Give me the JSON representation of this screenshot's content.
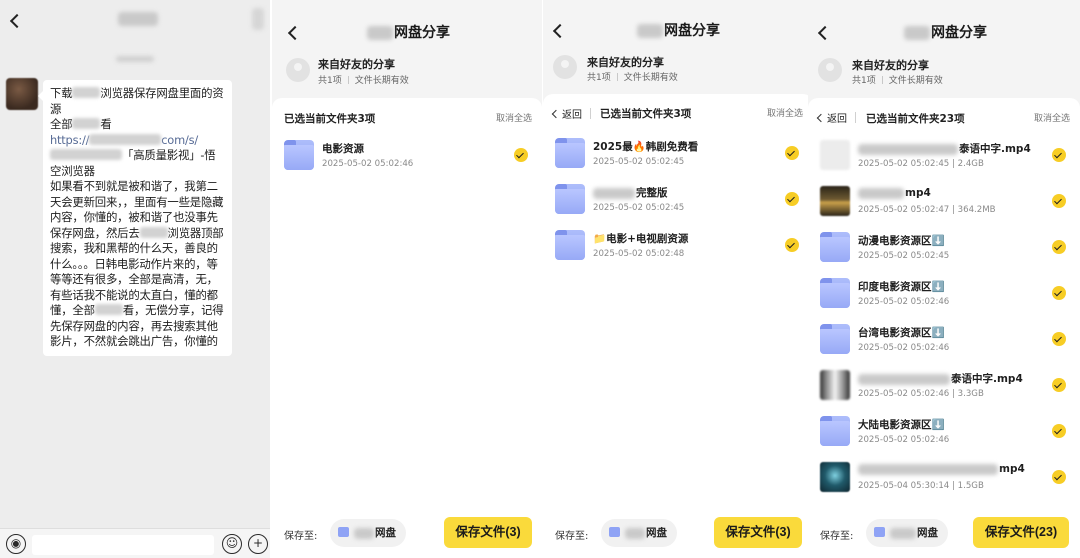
{
  "chat": {
    "message_lines": [
      {
        "pre": "下载",
        "post": "浏览器保存网盘里面的资"
      },
      {
        "text": "源"
      },
      {
        "pre": "全部",
        "post": "看"
      },
      {
        "link_pre": "https://",
        "link_post": "com/s/"
      },
      {
        "post": "「高质量影视」-悟"
      },
      {
        "text": "空浏览器"
      }
    ],
    "message_body_a": "如果看不到就是被和谐了，我第二天会更新回来，，里面有一些是隐藏内容，你懂的，被和谐了也没事先保存网盘，然后去",
    "message_body_b": "浏览器顶部搜索，我和黑帮的什么天，善良的什么。。。日韩电影动作片来的，等等等还有很多，全部是高清，无，有些话我不能说的太直白，懂的都懂，全部",
    "message_body_c": "看，无偿分享，记得先保存网盘的内容，再去搜索其他影片，不然就会跳出广告，你懂的"
  },
  "share_common": {
    "title_suffix": "网盘分享",
    "from_title": "来自好友的分享",
    "from_count": "共1项",
    "from_validity": "文件长期有效",
    "cancel_all": "取消全选",
    "back_label": "返回",
    "save_to_label": "保存至:",
    "dest_suffix": "网盘"
  },
  "panel1": {
    "selected": "已选当前文件夹3项",
    "items": [
      {
        "name": "电影资源",
        "meta": "2025-05-02 05:02:46"
      }
    ],
    "save_button": "保存文件(3)"
  },
  "panel2": {
    "selected": "已选当前文件夹3项",
    "items": [
      {
        "name": "2025最🔥韩剧免费看",
        "meta": "2025-05-02 05:02:45"
      },
      {
        "name_suffix": "完整版",
        "meta": "2025-05-02 05:02:45"
      },
      {
        "name": "📁电影+电视剧资源",
        "meta": "2025-05-02 05:02:48"
      }
    ],
    "save_button": "保存文件(3)"
  },
  "panel3": {
    "selected": "已选当前文件夹23项",
    "items": [
      {
        "name_suffix": "泰语中字.mp4",
        "meta": "2025-05-02 05:02:45 | 2.4GB"
      },
      {
        "name_suffix": "mp4",
        "meta": "2025-05-02 05:02:47 | 364.2MB"
      },
      {
        "name": "动漫电影资源区⬇️",
        "meta": "2025-05-02 05:02:45"
      },
      {
        "name": "印度电影资源区⬇️",
        "meta": "2025-05-02 05:02:46"
      },
      {
        "name": "台湾电影资源区⬇️",
        "meta": "2025-05-02 05:02:46"
      },
      {
        "name_suffix": "泰语中字.mp4",
        "meta": "2025-05-02 05:02:46 | 3.3GB"
      },
      {
        "name": "大陆电影资源区⬇️",
        "meta": "2025-05-02 05:02:46"
      },
      {
        "name_suffix": "mp4",
        "meta": "2025-05-04 05:30:14 | 1.5GB"
      }
    ],
    "save_button": "保存文件(23)"
  }
}
